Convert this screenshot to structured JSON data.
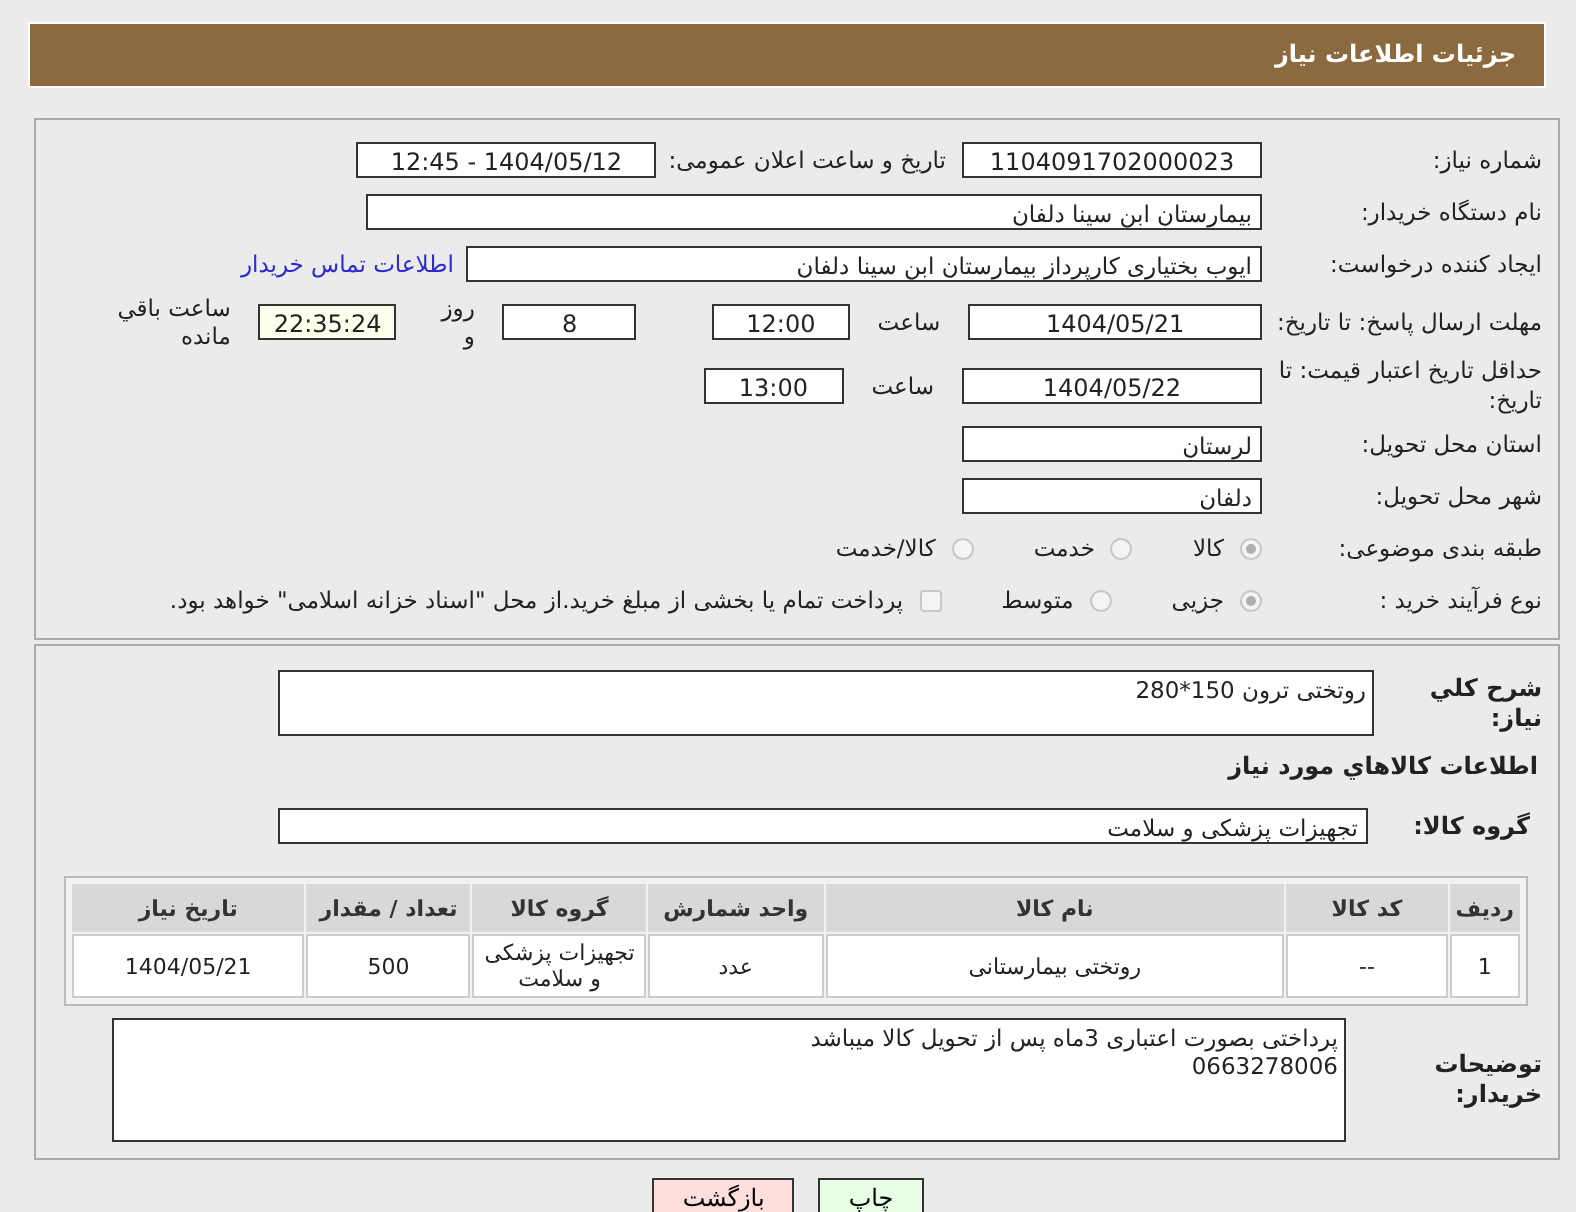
{
  "header": {
    "title": "جزئیات اطلاعات نیاز"
  },
  "need_number": {
    "label": "شماره نیاز:",
    "value": "1104091702000023"
  },
  "announce": {
    "label": "تاریخ و ساعت اعلان عمومی:",
    "value": "1404/05/12 - 12:45"
  },
  "buyer_org": {
    "label": "نام دستگاه خریدار:",
    "value": "بیمارستان ابن سینا دلفان"
  },
  "requester": {
    "label": "ایجاد کننده درخواست:",
    "value": "ایوب بختیاری کارپرداز بیمارستان ابن سینا دلفان",
    "link": "اطلاعات تماس خریدار"
  },
  "response_deadline": {
    "label": "مهلت ارسال پاسخ: تا تاریخ:",
    "date": "1404/05/21",
    "time_label": "ساعت",
    "time": "12:00",
    "days": "8",
    "days_label": "روز و",
    "remaining": "22:35:24",
    "remaining_label": "ساعت باقي مانده"
  },
  "price_validity": {
    "label": "حداقل تاریخ اعتبار قیمت: تا تاریخ:",
    "date": "1404/05/22",
    "time_label": "ساعت",
    "time": "13:00"
  },
  "province": {
    "label": "استان محل تحویل:",
    "value": "لرستان"
  },
  "city": {
    "label": "شهر محل تحویل:",
    "value": "دلفان"
  },
  "category": {
    "label": "طبقه بندی موضوعی:",
    "options": [
      {
        "label": "کالا",
        "selected": true
      },
      {
        "label": "خدمت",
        "selected": false
      },
      {
        "label": "کالا/خدمت",
        "selected": false
      }
    ]
  },
  "process": {
    "label": "نوع فرآیند خرید :",
    "options": [
      {
        "label": "جزیی",
        "selected": true
      },
      {
        "label": "متوسط",
        "selected": false
      }
    ],
    "payment": {
      "checked": false,
      "text": "پرداخت تمام یا بخشی از مبلغ خرید.از محل \"اسناد خزانه اسلامی\" خواهد بود."
    }
  },
  "description": {
    "label": "شرح کلي نياز:",
    "value": "روتختی ترون 150*280"
  },
  "goods_heading": "اطلاعات کالاهاي مورد نياز",
  "goods_group": {
    "label": "گروه کالا:",
    "value": "تجهیزات پزشکی و سلامت"
  },
  "table": {
    "columns": [
      "ردیف",
      "کد کالا",
      "نام کالا",
      "واحد شمارش",
      "گروه کالا",
      "تعداد / مقدار",
      "تاریخ نیاز"
    ],
    "rows": [
      [
        "1",
        "--",
        "روتختی بیمارستانی",
        "عدد",
        "تجهیزات پزشکی و سلامت",
        "500",
        "1404/05/21"
      ]
    ]
  },
  "buyer_notes": {
    "label": "توضیحات خریدار:",
    "lines": [
      "پرداختی بصورت اعتباری 3ماه پس از تحویل کالا میباشد",
      "0663278006"
    ]
  },
  "buttons": [
    {
      "label": "چاپ",
      "kind": "print"
    },
    {
      "label": "بازگشت",
      "kind": "back"
    }
  ]
}
